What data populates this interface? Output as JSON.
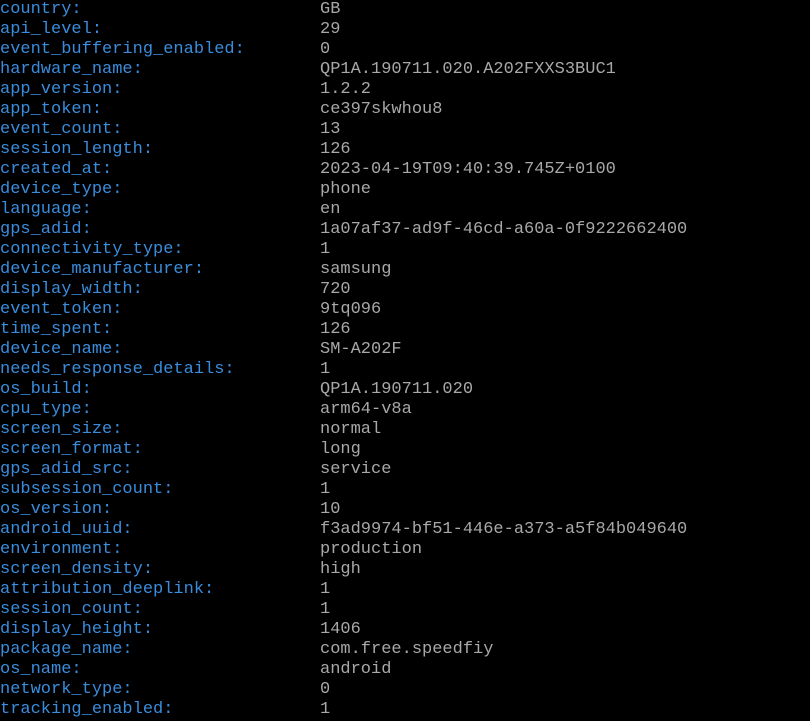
{
  "entries": [
    {
      "key": "country:",
      "value": "GB"
    },
    {
      "key": "api_level:",
      "value": "29"
    },
    {
      "key": "event_buffering_enabled:",
      "value": "0"
    },
    {
      "key": "hardware_name:",
      "value": "QP1A.190711.020.A202FXXS3BUC1"
    },
    {
      "key": "app_version:",
      "value": "1.2.2"
    },
    {
      "key": "app_token:",
      "value": "ce397skwhou8"
    },
    {
      "key": "event_count:",
      "value": "13"
    },
    {
      "key": "session_length:",
      "value": "126"
    },
    {
      "key": "created_at:",
      "value": "2023-04-19T09:40:39.745Z+0100"
    },
    {
      "key": "device_type:",
      "value": "phone"
    },
    {
      "key": "language:",
      "value": "en"
    },
    {
      "key": "gps_adid:",
      "value": "1a07af37-ad9f-46cd-a60a-0f9222662400"
    },
    {
      "key": "connectivity_type:",
      "value": "1"
    },
    {
      "key": "device_manufacturer:",
      "value": "samsung"
    },
    {
      "key": "display_width:",
      "value": "720"
    },
    {
      "key": "event_token:",
      "value": "9tq096"
    },
    {
      "key": "time_spent:",
      "value": "126"
    },
    {
      "key": "device_name:",
      "value": "SM-A202F"
    },
    {
      "key": "needs_response_details:",
      "value": "1"
    },
    {
      "key": "os_build:",
      "value": "QP1A.190711.020"
    },
    {
      "key": "cpu_type:",
      "value": "arm64-v8a"
    },
    {
      "key": "screen_size:",
      "value": "normal"
    },
    {
      "key": "screen_format:",
      "value": "long"
    },
    {
      "key": "gps_adid_src:",
      "value": "service"
    },
    {
      "key": "subsession_count:",
      "value": "1"
    },
    {
      "key": "os_version:",
      "value": "10"
    },
    {
      "key": "android_uuid:",
      "value": "f3ad9974-bf51-446e-a373-a5f84b049640"
    },
    {
      "key": "environment:",
      "value": "production"
    },
    {
      "key": "screen_density:",
      "value": "high"
    },
    {
      "key": "attribution_deeplink:",
      "value": "1"
    },
    {
      "key": "session_count:",
      "value": "1"
    },
    {
      "key": "display_height:",
      "value": "1406"
    },
    {
      "key": "package_name:",
      "value": "com.free.speedfiy"
    },
    {
      "key": "os_name:",
      "value": "android"
    },
    {
      "key": "network_type:",
      "value": "0"
    },
    {
      "key": "tracking_enabled:",
      "value": "1"
    }
  ]
}
